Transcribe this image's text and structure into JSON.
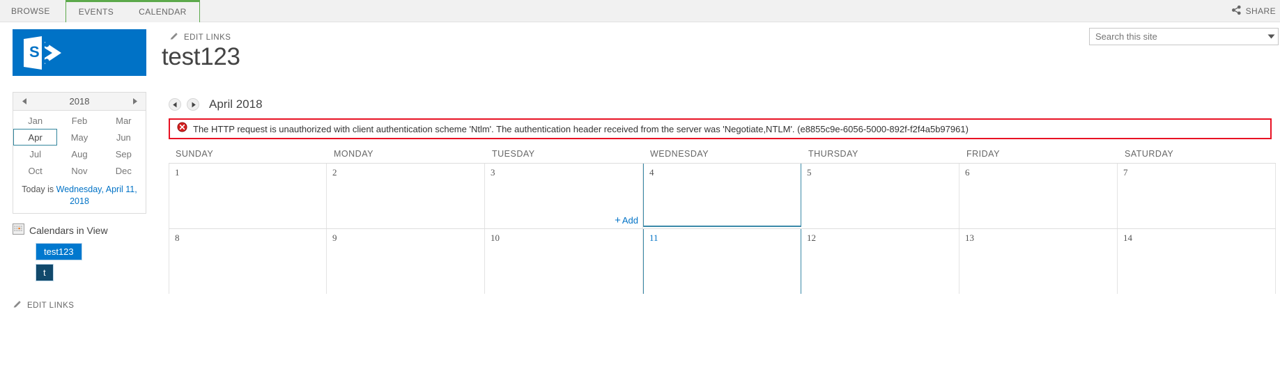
{
  "ribbon": {
    "tabs": [
      {
        "label": "BROWSE",
        "name": "browse",
        "grouped": false,
        "active": false
      },
      {
        "label": "EVENTS",
        "name": "events",
        "grouped": true,
        "active": true
      },
      {
        "label": "CALENDAR",
        "name": "calendar",
        "grouped": true,
        "active": false
      }
    ],
    "share_label": "SHARE",
    "accent_green": "#5ca94b"
  },
  "header": {
    "logo_alt": "SharePoint",
    "logo_color": "#0072c6",
    "edit_links_label": "EDIT LINKS",
    "site_title": "test123"
  },
  "search": {
    "placeholder": "Search this site",
    "value": ""
  },
  "minicalendar": {
    "year": "2018",
    "prev_arrow": "◄",
    "next_arrow": "►",
    "months": [
      "Jan",
      "Feb",
      "Mar",
      "Apr",
      "May",
      "Jun",
      "Jul",
      "Aug",
      "Sep",
      "Oct",
      "Nov",
      "Dec"
    ],
    "selected_month": "Apr",
    "today_prefix": "Today is ",
    "today_link": "Wednesday, April 11, 2018",
    "selected_border_color": "#31859c"
  },
  "calendars_in_view": {
    "heading": "Calendars in View",
    "chips": [
      {
        "label": "test123",
        "color": "#0078ce",
        "style": "primary"
      },
      {
        "label": "t",
        "color": "#11496b",
        "style": "secondary"
      }
    ]
  },
  "left_nav": {
    "edit_links_label": "EDIT LINKS"
  },
  "calendar": {
    "prev_label": "Previous month",
    "next_label": "Next month",
    "month_label": "April 2018",
    "day_headers": [
      "SUNDAY",
      "MONDAY",
      "TUESDAY",
      "WEDNESDAY",
      "THURSDAY",
      "FRIDAY",
      "SATURDAY"
    ],
    "today_column_index": 3,
    "today_day": "11",
    "today_highlight_color": "#3a89a8",
    "add_label": "Add",
    "add_cell_index": 2,
    "weeks": [
      {
        "days": [
          "1",
          "2",
          "3",
          "4",
          "5",
          "6",
          "7"
        ]
      },
      {
        "days": [
          "8",
          "9",
          "10",
          "11",
          "12",
          "13",
          "14"
        ]
      }
    ]
  },
  "error": {
    "icon": "error-circle-icon",
    "border_color": "#e81123",
    "message": "The HTTP request is unauthorized with client authentication scheme 'Ntlm'. The authentication header received from the server was 'Negotiate,NTLM'. (e8855c9e-6056-5000-892f-f2f4a5b97961)"
  }
}
